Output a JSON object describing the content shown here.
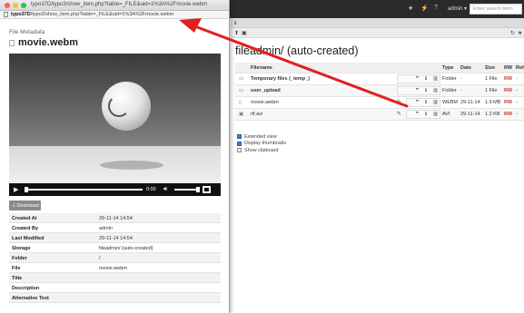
{
  "popup": {
    "window_title": "typo37D/typo3/show_item.php?table=_FILE&uid=1%3A%2Fmovie.webm",
    "url_bold": "typo37D",
    "url_rest": "/typo3/show_item.php?table=_FILE&uid=1%3A%2Fmovie.webm",
    "heading": "File Metadata",
    "file_name": "movie.webm",
    "video": {
      "time": "0:00"
    },
    "download_label": "Download",
    "metadata": [
      {
        "label": "Created At",
        "value": "29-11-14 14:54"
      },
      {
        "label": "Created By",
        "value": "admin"
      },
      {
        "label": "Last Modified",
        "value": "29-11-14 14:54"
      },
      {
        "label": "Storage",
        "value": "fileadmin/ (auto-created)"
      },
      {
        "label": "Folder",
        "value": "/"
      },
      {
        "label": "File",
        "value": "movie.webm"
      },
      {
        "label": "Title",
        "value": ""
      },
      {
        "label": "Description",
        "value": ""
      },
      {
        "label": "Alternative Text",
        "value": ""
      }
    ]
  },
  "backend": {
    "topbar": {
      "admin_label": "admin",
      "search_placeholder": "Enter search term"
    },
    "page_title": "fileadmin/ (auto-created)",
    "columns": {
      "filename": "Filename",
      "type": "Type",
      "date": "Date",
      "size": "Size",
      "rw": "RW",
      "ref": "Ref"
    },
    "rows": [
      {
        "name": "Temporary files (_temp_)",
        "type": "Folder",
        "date": "-",
        "size": "1 File",
        "rw": "RW",
        "ref": "-"
      },
      {
        "name": "user_upload",
        "type": "Folder",
        "date": "-",
        "size": "1 File",
        "rw": "RW",
        "ref": "-"
      },
      {
        "name": "movie.webm",
        "type": "WEBM",
        "date": "29-11-14",
        "size": "1.9 MB",
        "rw": "RW",
        "ref": "-"
      },
      {
        "name": "rlf.avi",
        "type": "AVI",
        "date": "29-11-14",
        "size": "1.2 KB",
        "rw": "RW",
        "ref": "-"
      }
    ],
    "options": [
      {
        "label": "Extended view",
        "checked": true
      },
      {
        "label": "Display thumbnails",
        "checked": true
      },
      {
        "label": "Show clipboard",
        "checked": false
      }
    ]
  },
  "colors": {
    "annotation_arrow": "#e02020",
    "rw": "#c83c3c"
  }
}
